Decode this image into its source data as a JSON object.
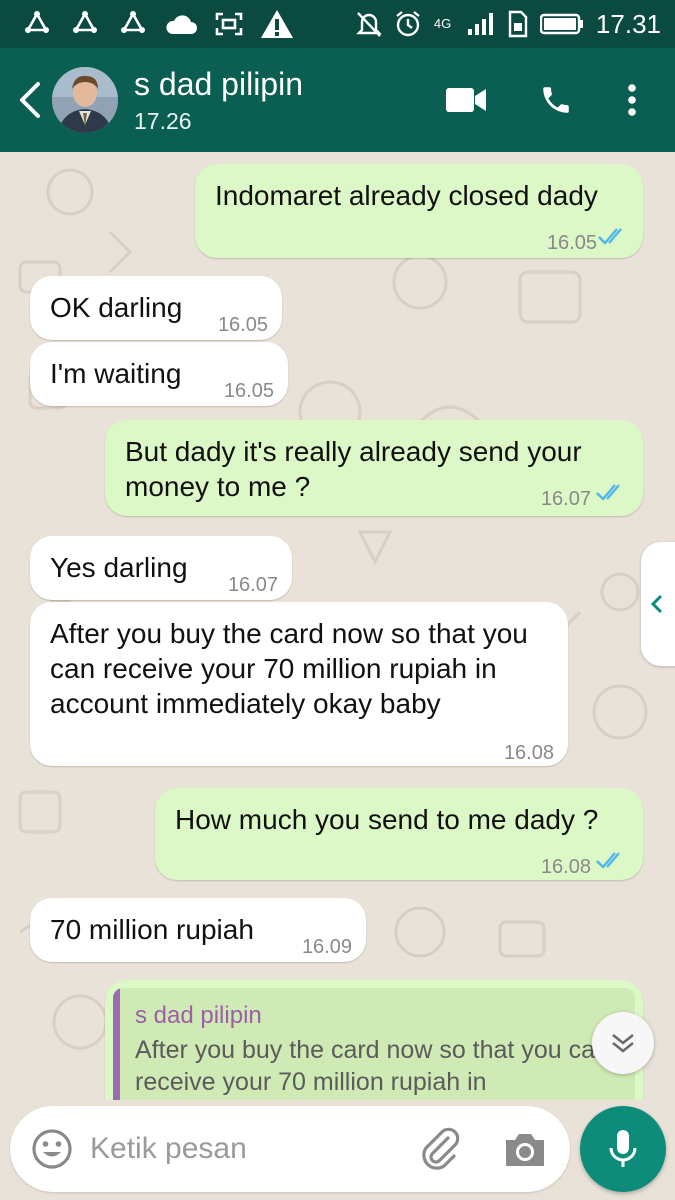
{
  "status_bar": {
    "time": "17.31",
    "network_label": "4G",
    "icons": [
      "sync-icon",
      "sync-icon",
      "sync-icon",
      "cloud-icon",
      "screenshot-icon",
      "warning-icon",
      "mute-icon",
      "alarm-icon",
      "signal-icon",
      "battery-icon"
    ]
  },
  "header": {
    "contact_name": "s dad pilipin",
    "last_seen": "17.26",
    "colors": {
      "bar": "#0b5e52",
      "status": "#0a4a40"
    }
  },
  "messages": [
    {
      "dir": "out",
      "text": "Indomaret already closed dady",
      "time": "16.05",
      "read": true
    },
    {
      "dir": "in",
      "text": "OK darling",
      "time": "16.05"
    },
    {
      "dir": "in",
      "text": "I'm waiting",
      "time": "16.05"
    },
    {
      "dir": "out",
      "text": "But dady it's really  already send your money to me ?",
      "time": "16.07",
      "read": true
    },
    {
      "dir": "in",
      "text": "Yes darling",
      "time": "16.07"
    },
    {
      "dir": "in",
      "text": "After you buy the card now so that you can receive your 70 million rupiah in account immediately okay baby",
      "time": "16.08"
    },
    {
      "dir": "out",
      "text": "How much you send to me dady ?",
      "time": "16.08",
      "read": true
    },
    {
      "dir": "in",
      "text": "70 million rupiah",
      "time": "16.09"
    }
  ],
  "reply_preview": {
    "name": "s dad pilipin",
    "text": "After you buy the card now so that you can receive your 70 million rupiah in"
  },
  "input": {
    "placeholder": "Ketik pesan"
  },
  "colors": {
    "incoming": "#ffffff",
    "outgoing": "#dcf8c6",
    "read_ticks": "#4fb6ec",
    "mic_button": "#0d8c7a"
  }
}
